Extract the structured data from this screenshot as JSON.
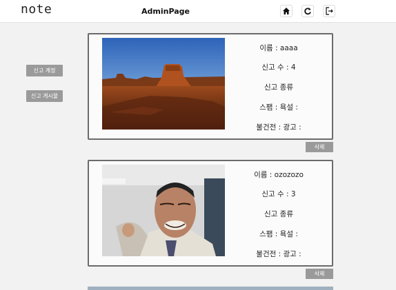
{
  "header": {
    "logo": "note",
    "title": "AdminPage",
    "icons": [
      "home-icon",
      "refresh-icon",
      "logout-icon"
    ]
  },
  "sidebar": {
    "reported_accounts_label": "신고 계정",
    "reported_posts_label": "신고 게시물"
  },
  "reports": [
    {
      "name_line": "이름 : aaaa",
      "count_line": "신고 수 : 4",
      "type_heading": "신고 종류",
      "spam_line": "스팸 : 욕설 :",
      "lewd_line": "불건전 : 광고 :",
      "delete_label": "삭제"
    },
    {
      "name_line": "이름 : ozozozo",
      "count_line": "신고 수 : 3",
      "type_heading": "신고 종류",
      "spam_line": "스팸 : 욕설 :",
      "lewd_line": "불건전 : 광고 :",
      "delete_label": "삭제"
    }
  ]
}
